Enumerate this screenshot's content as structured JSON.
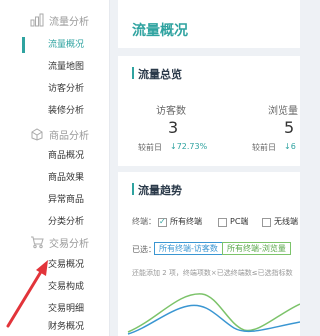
{
  "sidebar": {
    "sections": [
      {
        "title": "流量分析",
        "icon": "chart-icon",
        "items": [
          "流量概况",
          "流量地图",
          "访客分析",
          "装修分析"
        ]
      },
      {
        "title": "商品分析",
        "icon": "goods-icon",
        "items": [
          "商品概况",
          "商品效果",
          "异常商品",
          "分类分析"
        ]
      },
      {
        "title": "交易分析",
        "icon": "cart-icon",
        "items": [
          "交易概况",
          "交易构成",
          "交易明细",
          "财务概况"
        ]
      }
    ],
    "active_item": "流量概况"
  },
  "page": {
    "title": "流量概况"
  },
  "overview": {
    "title": "流量总览",
    "metrics": [
      {
        "name": "访客数",
        "value": "3",
        "compare_label": "较前日",
        "delta": "72.73%",
        "direction": "down"
      },
      {
        "name": "浏览量",
        "value": "5",
        "compare_label": "较前日",
        "delta": "6",
        "direction": "down"
      }
    ]
  },
  "trend": {
    "title": "流量趋势",
    "terminal_label": "终端：",
    "terminal_options": [
      {
        "label": "所有终端",
        "checked": true
      },
      {
        "label": "PC端",
        "checked": false
      },
      {
        "label": "无线端",
        "checked": false
      }
    ],
    "selected_label": "已选：",
    "selected_tags": [
      "所有终端-访客数",
      "所有终端-浏览量"
    ],
    "hint": "还能添加 2 项，终端项数×已选终端数≤已选指标数",
    "chart_data": {
      "type": "line",
      "series": [
        {
          "name": "所有终端-访客数",
          "color": "#3a96d2"
        },
        {
          "name": "所有终端-浏览量",
          "color": "#7cc36a"
        }
      ]
    }
  },
  "colors": {
    "accent": "#2fa3a0",
    "blue": "#3a96d2",
    "green": "#7cc36a",
    "arrow": "#e2343a"
  }
}
